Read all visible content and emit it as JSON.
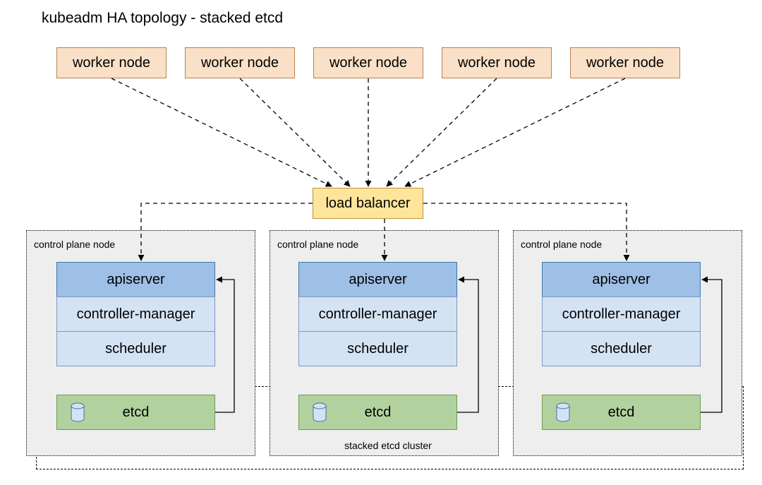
{
  "title": "kubeadm HA topology - stacked etcd",
  "workers": [
    "worker node",
    "worker node",
    "worker node",
    "worker node",
    "worker node"
  ],
  "load_balancer": "load balancer",
  "control_plane": {
    "label": "control plane node",
    "apiserver": "apiserver",
    "controller_manager": "controller-manager",
    "scheduler": "scheduler",
    "etcd": "etcd"
  },
  "etcd_cluster_label": "stacked etcd cluster",
  "colors": {
    "worker_fill": "#f9e0c7",
    "worker_border": "#b98254",
    "lb_fill": "#ffe59c",
    "lb_border": "#bb9237",
    "apiserver_fill": "#9ebfe6",
    "apiserver_border": "#3c74ab",
    "light_fill": "#d4e3f4",
    "light_border": "#7b97c1",
    "etcd_fill": "#b1d29f",
    "etcd_border": "#6a9b51",
    "cp_fill": "#eeeeee",
    "cyl_fill": "#d4e3f4",
    "cyl_stroke": "#3c74ab"
  }
}
